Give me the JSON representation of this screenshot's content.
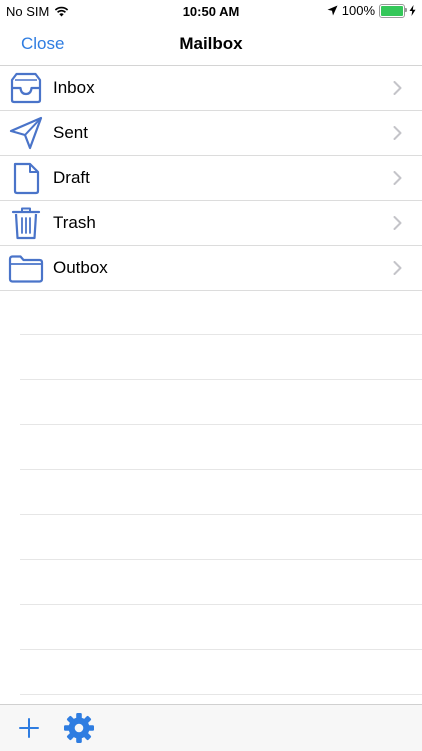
{
  "status_bar": {
    "carrier": "No SIM",
    "time": "10:50 AM",
    "battery": "100%",
    "battery_level": 1.0,
    "icons": [
      "wifi-icon",
      "location-arrow-icon",
      "battery-icon",
      "charging-bolt-icon"
    ]
  },
  "nav": {
    "close_label": "Close",
    "title": "Mailbox"
  },
  "folders": [
    {
      "label": "Inbox",
      "icon": "inbox-tray-icon"
    },
    {
      "label": "Sent",
      "icon": "paper-plane-icon"
    },
    {
      "label": "Draft",
      "icon": "document-icon"
    },
    {
      "label": "Trash",
      "icon": "trash-can-icon"
    },
    {
      "label": "Outbox",
      "icon": "folder-icon"
    }
  ],
  "toolbar": {
    "icons": [
      "plus-icon",
      "gear-icon"
    ]
  },
  "colors": {
    "accent": "#2f7de1",
    "icon_stroke": "#4a74c9",
    "chevron": "#c4c4c9",
    "battery_fill": "#34c759"
  }
}
